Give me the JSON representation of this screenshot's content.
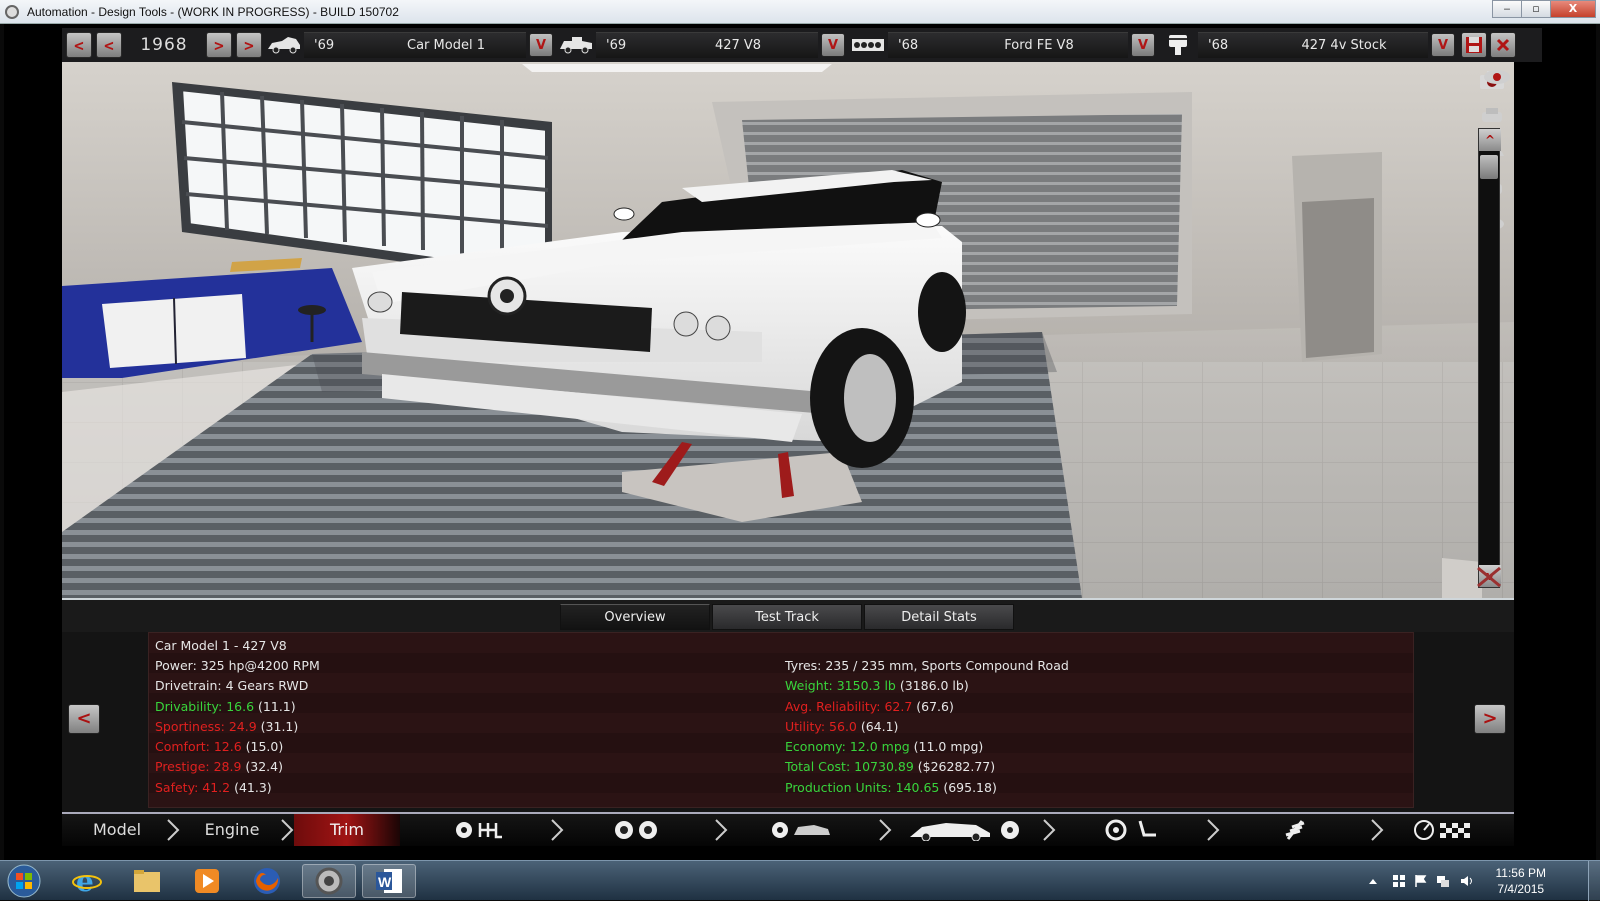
{
  "window": {
    "title": "Automation - Design Tools - (WORK IN PROGRESS) - BUILD 150702",
    "minimize": "‒",
    "maximize": "▫",
    "close": "X"
  },
  "toolbar": {
    "year": "1968",
    "segments": [
      {
        "year": "'69",
        "name": "Car Model 1"
      },
      {
        "year": "'69",
        "name": "427 V8"
      },
      {
        "year": "'68",
        "name": "Ford FE V8"
      },
      {
        "year": "'68",
        "name": "427 4v Stock"
      }
    ],
    "dropdown_glyph": "V",
    "prev_glyph": "<",
    "next_glyph": ">"
  },
  "viewport": {
    "scroll_up": "^",
    "scroll_down": "v"
  },
  "tabs": [
    "Overview",
    "Test Track",
    "Detail Stats"
  ],
  "stats": {
    "title": "Car Model 1 - 427 V8",
    "power": "Power: 325 hp@4200 RPM",
    "drivetrain": "Drivetrain: 4 Gears RWD",
    "drivability": {
      "label": "Drivability: 16.6",
      "extra": " (11.1)"
    },
    "sportiness": {
      "label": "Sportiness: 24.9",
      "extra": " (31.1)"
    },
    "comfort": {
      "label": "Comfort: 12.6",
      "extra": " (15.0)"
    },
    "prestige": {
      "label": "Prestige: 28.9",
      "extra": " (32.4)"
    },
    "safety": {
      "label": "Safety: 41.2",
      "extra": " (41.3)"
    },
    "tyres": "Tyres: 235 / 235 mm, Sports Compound Road",
    "weight": {
      "label": "Weight: 3150.3 lb",
      "extra": " (3186.0 lb)"
    },
    "reliability": {
      "label": "Avg. Reliability: 62.7",
      "extra": " (67.6)"
    },
    "utility": {
      "label": "Utility: 56.0",
      "extra": " (64.1)"
    },
    "economy": {
      "label": "Economy: 12.0 mpg",
      "extra": " (11.0 mpg)"
    },
    "total_cost": {
      "label": "Total Cost: 10730.89",
      "extra": " ($26282.77)"
    },
    "production_units": {
      "label": "Production Units: 140.65",
      "extra": " (695.18)"
    }
  },
  "nav": {
    "prev": "<",
    "next": ">",
    "model": "Model",
    "engine": "Engine",
    "trim": "Trim"
  },
  "taskbar": {
    "time": "11:56 PM",
    "date": "7/4/2015"
  },
  "colors": {
    "good": "#39d43c",
    "bad": "#e0201f",
    "accent": "#a01414"
  }
}
